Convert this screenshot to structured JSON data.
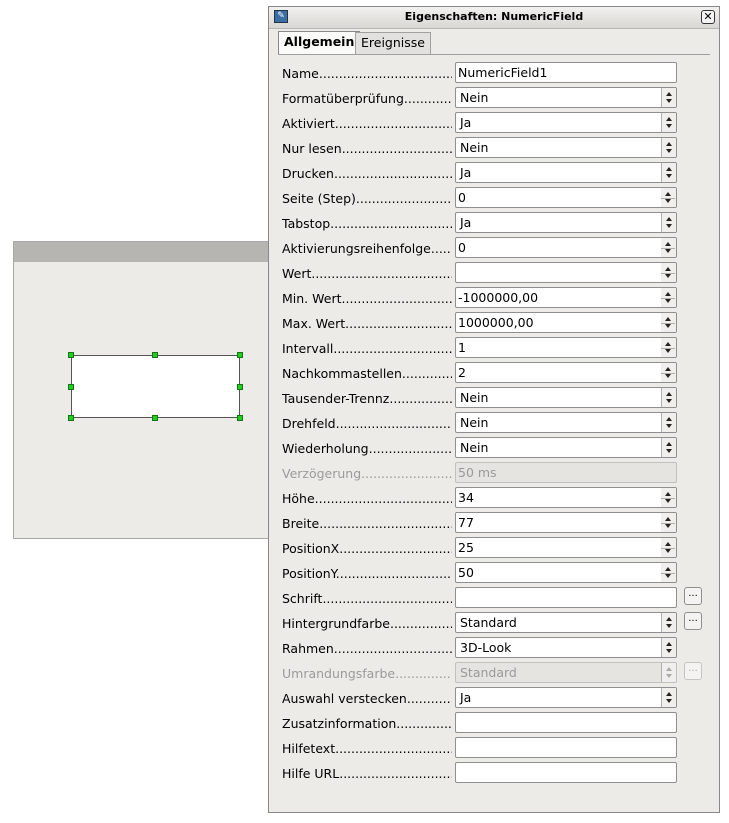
{
  "dialog": {
    "title": "Eigenschaften: NumericField",
    "tabs": [
      "Allgemein",
      "Ereignisse"
    ],
    "active_tab": "Allgemein"
  },
  "icons": {
    "app": "document-icon",
    "close": "close-icon",
    "spin": "spin-arrows-icon",
    "dropdown": "dropdown-arrows-icon"
  },
  "properties": [
    {
      "label": "Name",
      "value": "NumericField1",
      "kind": "text"
    },
    {
      "label": "Formatüberprüfung",
      "value": "Nein",
      "kind": "list"
    },
    {
      "label": "Aktiviert",
      "value": "Ja",
      "kind": "list"
    },
    {
      "label": "Nur lesen",
      "value": "Nein",
      "kind": "list"
    },
    {
      "label": "Drucken",
      "value": "Ja",
      "kind": "list"
    },
    {
      "label": "Seite (Step)",
      "value": "0",
      "kind": "spin"
    },
    {
      "label": "Tabstop",
      "value": "Ja",
      "kind": "list"
    },
    {
      "label": "Aktivierungsreihenfolge",
      "value": "0",
      "kind": "spin"
    },
    {
      "label": "Wert",
      "value": "",
      "kind": "spin"
    },
    {
      "label": "Min. Wert",
      "value": "-1000000,00",
      "kind": "spin"
    },
    {
      "label": "Max. Wert",
      "value": "1000000,00",
      "kind": "spin"
    },
    {
      "label": "Intervall",
      "value": "1",
      "kind": "spin"
    },
    {
      "label": "Nachkommastellen",
      "value": "2",
      "kind": "spin"
    },
    {
      "label": "Tausender-Trennz",
      "value": "Nein",
      "kind": "list"
    },
    {
      "label": "Drehfeld",
      "value": "Nein",
      "kind": "list"
    },
    {
      "label": "Wiederholung",
      "value": "Nein",
      "kind": "list"
    },
    {
      "label": "Verzögerung",
      "value": "50 ms",
      "kind": "text",
      "disabled": true
    },
    {
      "label": "Höhe",
      "value": "34",
      "kind": "spin"
    },
    {
      "label": "Breite",
      "value": "77",
      "kind": "spin"
    },
    {
      "label": "PositionX",
      "value": "25",
      "kind": "spin"
    },
    {
      "label": "PositionY",
      "value": "50",
      "kind": "spin"
    },
    {
      "label": "Schrift",
      "value": "",
      "kind": "text",
      "button": "..."
    },
    {
      "label": "Hintergrundfarbe",
      "value": "Standard",
      "kind": "list",
      "button": "..."
    },
    {
      "label": "Rahmen",
      "value": "3D-Look",
      "kind": "list"
    },
    {
      "label": "Umrandungsfarbe",
      "value": "Standard",
      "kind": "list",
      "button": "...",
      "disabled": true
    },
    {
      "label": "Auswahl verstecken",
      "value": "Ja",
      "kind": "list"
    },
    {
      "label": "Zusatzinformation",
      "value": "",
      "kind": "text"
    },
    {
      "label": "Hilfetext",
      "value": "",
      "kind": "text"
    },
    {
      "label": "Hilfe URL",
      "value": "",
      "kind": "text"
    }
  ]
}
